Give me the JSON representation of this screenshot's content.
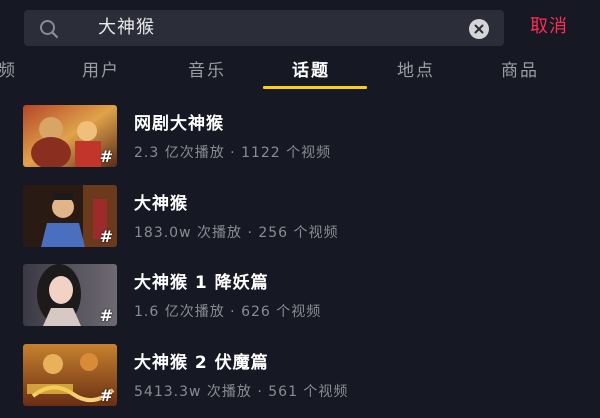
{
  "search": {
    "query": "大神猴",
    "cancel_label": "取消"
  },
  "tabs": [
    {
      "label": "频"
    },
    {
      "label": "用户"
    },
    {
      "label": "音乐"
    },
    {
      "label": "话题",
      "active": true
    },
    {
      "label": "地点"
    },
    {
      "label": "商品"
    }
  ],
  "results": [
    {
      "title": "网剧大神猴",
      "plays": "2.3 亿次播放",
      "separator": "·",
      "videos": "1122 个视频",
      "tag": "#"
    },
    {
      "title": "大神猴",
      "plays": "183.0w 次播放",
      "separator": "·",
      "videos": "256 个视频",
      "tag": "#"
    },
    {
      "title": "大神猴 1 降妖篇",
      "plays": "1.6 亿次播放",
      "separator": "·",
      "videos": "626 个视频",
      "tag": "#"
    },
    {
      "title": "大神猴 2 伏魔篇",
      "plays": "5413.3w 次播放",
      "separator": "·",
      "videos": "561 个视频",
      "tag": "#"
    }
  ],
  "colors": {
    "background": "#161823",
    "accent_red": "#fe2c55",
    "tab_indicator": "#face15"
  },
  "icons": [
    "search-icon",
    "clear-icon",
    "topic-hash-icon"
  ]
}
